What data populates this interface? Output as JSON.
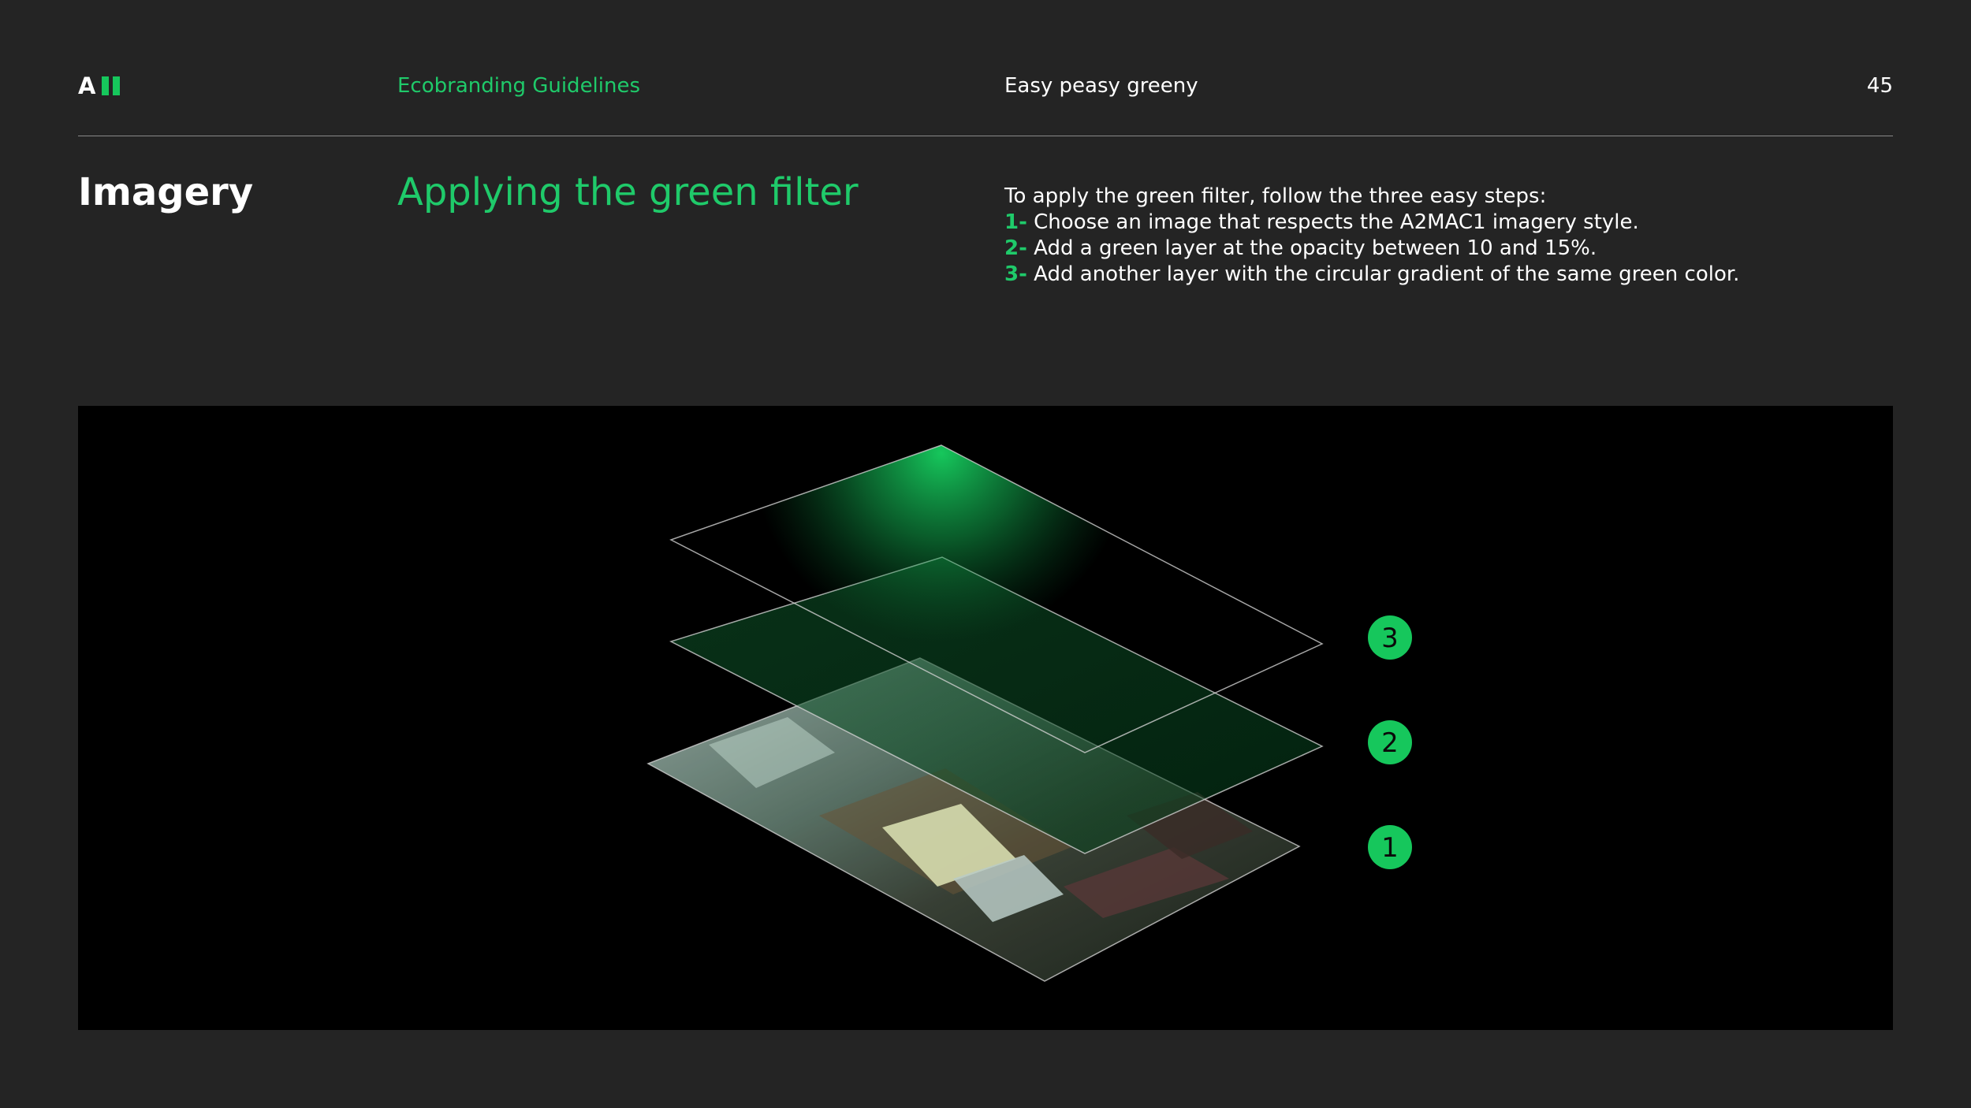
{
  "header": {
    "logo_letter": "A",
    "section_name": "Ecobranding Guidelines",
    "tagline": "Easy peasy greeny",
    "page_number": "45"
  },
  "title": "Imagery",
  "subtitle": "Applying the green filter",
  "instructions": {
    "intro": "To apply the green filter, follow the three easy steps:",
    "steps": [
      {
        "num": "1-",
        "text": "Choose an image that respects the A2MAC1 imagery style."
      },
      {
        "num": "2-",
        "text": "Add a green layer at the opacity between 10 and 15%."
      },
      {
        "num": "3-",
        "text": "Add another layer with the circular gradient of the same green color."
      }
    ]
  },
  "figure": {
    "badges": [
      "3",
      "2",
      "1"
    ],
    "colors": {
      "brand_green": "#16c75c",
      "background": "#000000"
    }
  }
}
